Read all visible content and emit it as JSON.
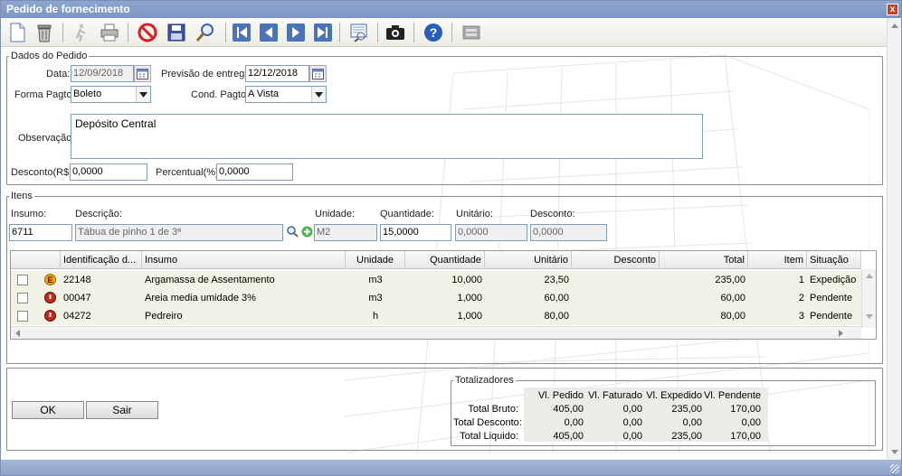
{
  "window": {
    "title": "Pedido de fornecimento",
    "close": "x"
  },
  "toolbar": {
    "icons": [
      "new-document-icon",
      "trash-icon",
      "walk-icon",
      "print-icon",
      "cancel-icon",
      "save-icon",
      "search-icon",
      "first-icon",
      "previous-icon",
      "next-icon",
      "last-icon",
      "report-icon",
      "camera-icon",
      "help-icon",
      "disabled-print-icon"
    ]
  },
  "dados": {
    "legend": "Dados do Pedido",
    "data_label": "Data:",
    "data_value": "12/09/2018",
    "previsao_label": "Previsão de entrega:",
    "previsao_value": "12/12/2018",
    "forma_label": "Forma Pagto:",
    "forma_value": "Boleto",
    "cond_label": "Cond. Pagto:",
    "cond_value": "A Vista",
    "obs_label": "Observação:",
    "obs_value": "Depósito Central",
    "desconto_label": "Desconto(R$):",
    "desconto_value": "0,0000",
    "percentual_label": "Percentual(%):",
    "percentual_value": "0,0000"
  },
  "itens": {
    "legend": "Itens",
    "insumo_label": "Insumo:",
    "insumo_value": "6711",
    "descricao_label": "Descrição:",
    "descricao_value": "Tábua de pinho 1  de 3ª",
    "unidade_label": "Unidade:",
    "unidade_value": "M2",
    "quantidade_label": "Quantidade:",
    "quantidade_value": "15,0000",
    "unitario_label": "Unitário:",
    "unitario_value": "0,0000",
    "desc_label": "Desconto:",
    "desc_value": "0,0000",
    "columns": [
      "Identificação d...",
      "Insumo",
      "Unidade",
      "Quantidade",
      "Unitário",
      "Desconto",
      "Total",
      "Item",
      "Situação"
    ],
    "rows": [
      {
        "status": "shipping",
        "id": "22148",
        "insumo": "Argamassa de Assentamento",
        "unidade": "m3",
        "quantidade": "10,000",
        "unitario": "23,50",
        "desconto": "",
        "total": "235,00",
        "item": "1",
        "situacao": "Expedição",
        "color": "#e8a317"
      },
      {
        "status": "pending",
        "id": "00047",
        "insumo": "Areia media umidade 3%",
        "unidade": "m3",
        "quantidade": "1,000",
        "unitario": "60,00",
        "desconto": "",
        "total": "60,00",
        "item": "2",
        "situacao": "Pendente",
        "color": "#c0281b"
      },
      {
        "status": "pending",
        "id": "04272",
        "insumo": "Pedreiro",
        "unidade": "h",
        "quantidade": "1,000",
        "unitario": "80,00",
        "desconto": "",
        "total": "80,00",
        "item": "3",
        "situacao": "Pendente",
        "color": "#c0281b"
      }
    ]
  },
  "buttons": {
    "ok": "OK",
    "sair": "Sair"
  },
  "totalizadores": {
    "legend": "Totalizadores",
    "headers": [
      "Vl. Pedido",
      "Vl. Faturado",
      "Vl. Expedido",
      "Vl. Pendente"
    ],
    "rows": [
      {
        "label": "Total Bruto:",
        "values": [
          "405,00",
          "0,00",
          "235,00",
          "170,00"
        ]
      },
      {
        "label": "Total Desconto:",
        "values": [
          "0,00",
          "0,00",
          "0,00",
          "0,00"
        ]
      },
      {
        "label": "Total Liquido:",
        "values": [
          "405,00",
          "0,00",
          "235,00",
          "170,00"
        ]
      }
    ]
  }
}
